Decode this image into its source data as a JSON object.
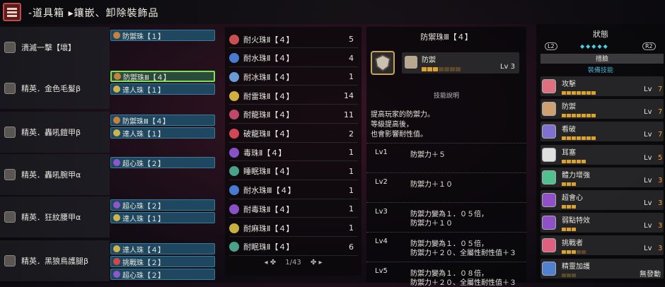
{
  "header": {
    "title": "-道具箱 ▸鑲嵌、卸除裝飾品"
  },
  "gear": [
    {
      "name": "潰滅一擊【壞】",
      "slots": [
        {
          "label": "防禦珠【１】",
          "color": "#c8813a"
        }
      ]
    },
    {
      "name": "精英．金色毛髮β",
      "slots": [
        {
          "label": "防禦珠Ⅲ【４】",
          "color": "#c8813a",
          "selected": true
        },
        {
          "label": "達人珠【１】",
          "color": "#cdb24e"
        }
      ]
    },
    {
      "name": "精英．轟吼鎧甲β",
      "slots": [
        {
          "label": "防禦珠Ⅲ【４】",
          "color": "#c8813a"
        },
        {
          "label": "達人珠【１】",
          "color": "#cdb24e"
        }
      ]
    },
    {
      "name": "精英．轟吼腕甲α",
      "slots": [
        {
          "label": "超心珠【２】",
          "color": "#8c58c8"
        }
      ]
    },
    {
      "name": "精英．狂紋腰甲α",
      "slots": [
        {
          "label": "超心珠【２】",
          "color": "#8c58c8"
        },
        {
          "label": "達人珠【１】",
          "color": "#cdb24e"
        }
      ]
    },
    {
      "name": "精英．黑狼鳥護腿β",
      "slots": [
        {
          "label": "達人珠【４】",
          "color": "#cdb24e"
        },
        {
          "label": "挑戰珠【２】",
          "color": "#d04848"
        },
        {
          "label": "超心珠【２】",
          "color": "#8c58c8"
        }
      ]
    }
  ],
  "jewels": [
    {
      "name": "耐火珠Ⅱ【４】",
      "qty": "5",
      "color": "#c85050"
    },
    {
      "name": "耐水珠Ⅱ【４】",
      "qty": "4",
      "color": "#4a7ad0"
    },
    {
      "name": "耐冰珠Ⅱ【４】",
      "qty": "1",
      "color": "#6a9ad8"
    },
    {
      "name": "耐雷珠Ⅱ【４】",
      "qty": "14",
      "color": "#d0b040"
    },
    {
      "name": "耐龍珠Ⅱ【４】",
      "qty": "11",
      "color": "#c04868"
    },
    {
      "name": "破龍珠Ⅱ【４】",
      "qty": "2",
      "color": "#d04858"
    },
    {
      "name": "毒珠Ⅱ【４】",
      "qty": "1",
      "color": "#8a50c8"
    },
    {
      "name": "睡眠珠Ⅱ【４】",
      "qty": "1",
      "color": "#4aa08a"
    },
    {
      "name": "耐水珠Ⅲ【４】",
      "qty": "1",
      "color": "#4a7ad0"
    },
    {
      "name": "耐毒珠Ⅱ【４】",
      "qty": "1",
      "color": "#8a50c8"
    },
    {
      "name": "耐麻珠Ⅱ【４】",
      "qty": "1",
      "color": "#c8b040"
    },
    {
      "name": "耐眠珠Ⅱ【４】",
      "qty": "6",
      "color": "#4aa08a"
    }
  ],
  "pager": {
    "text": "1/43"
  },
  "detail": {
    "title": "防禦珠Ⅲ【４】",
    "skill_name": "防禦",
    "skill_lv": "Lv 3",
    "skill_level": 3,
    "skill_max": 7,
    "section": "技能說明",
    "desc": [
      "提高玩家的防禦力。",
      "等級提高後，",
      "也會影響耐性值。"
    ],
    "levels": [
      {
        "lv": "Lv1",
        "lines": [
          "防禦力＋５"
        ]
      },
      {
        "lv": "Lv2",
        "lines": [
          "防禦力＋１０"
        ]
      },
      {
        "lv": "Lv3",
        "lines": [
          "防禦力變為１．０５倍，",
          "防禦力＋１０"
        ]
      },
      {
        "lv": "Lv4",
        "lines": [
          "防禦力變為１．０５倍，",
          "防禦力＋２０、全屬性耐性值＋３"
        ]
      },
      {
        "lv": "Lv5",
        "lines": [
          "防禦力變為１．０８倍，",
          "防禦力＋２０、全屬性耐性值＋３"
        ]
      }
    ]
  },
  "status": {
    "title": "狀態",
    "l2": "L2",
    "r2": "R2",
    "tab": "措臉",
    "sub": "裝備技能",
    "skills": [
      {
        "name": "攻擊",
        "lv": "Lv",
        "val": "7",
        "level": 7,
        "max": 7,
        "color": "#e07080"
      },
      {
        "name": "防禦",
        "lv": "Lv",
        "val": "7",
        "level": 7,
        "max": 7,
        "color": "#d0a070"
      },
      {
        "name": "看破",
        "lv": "Lv",
        "val": "7",
        "level": 7,
        "max": 7,
        "color": "#8070d0"
      },
      {
        "name": "耳塞",
        "lv": "Lv",
        "val": "5",
        "level": 5,
        "max": 5,
        "color": "#e0e0e0"
      },
      {
        "name": "體力增強",
        "lv": "Lv",
        "val": "3",
        "level": 3,
        "max": 3,
        "color": "#50c090"
      },
      {
        "name": "超會心",
        "lv": "Lv",
        "val": "3",
        "level": 3,
        "max": 3,
        "color": "#9050c8"
      },
      {
        "name": "弱點特效",
        "lv": "Lv",
        "val": "3",
        "level": 3,
        "max": 3,
        "color": "#9050c8"
      },
      {
        "name": "挑戰者",
        "lv": "Lv",
        "val": "3",
        "level": 3,
        "max": 5,
        "color": "#e06080"
      },
      {
        "name": "精靈加護",
        "lv": "",
        "val": "無發動",
        "level": 0,
        "max": 3,
        "color": "#5080d0"
      }
    ]
  }
}
